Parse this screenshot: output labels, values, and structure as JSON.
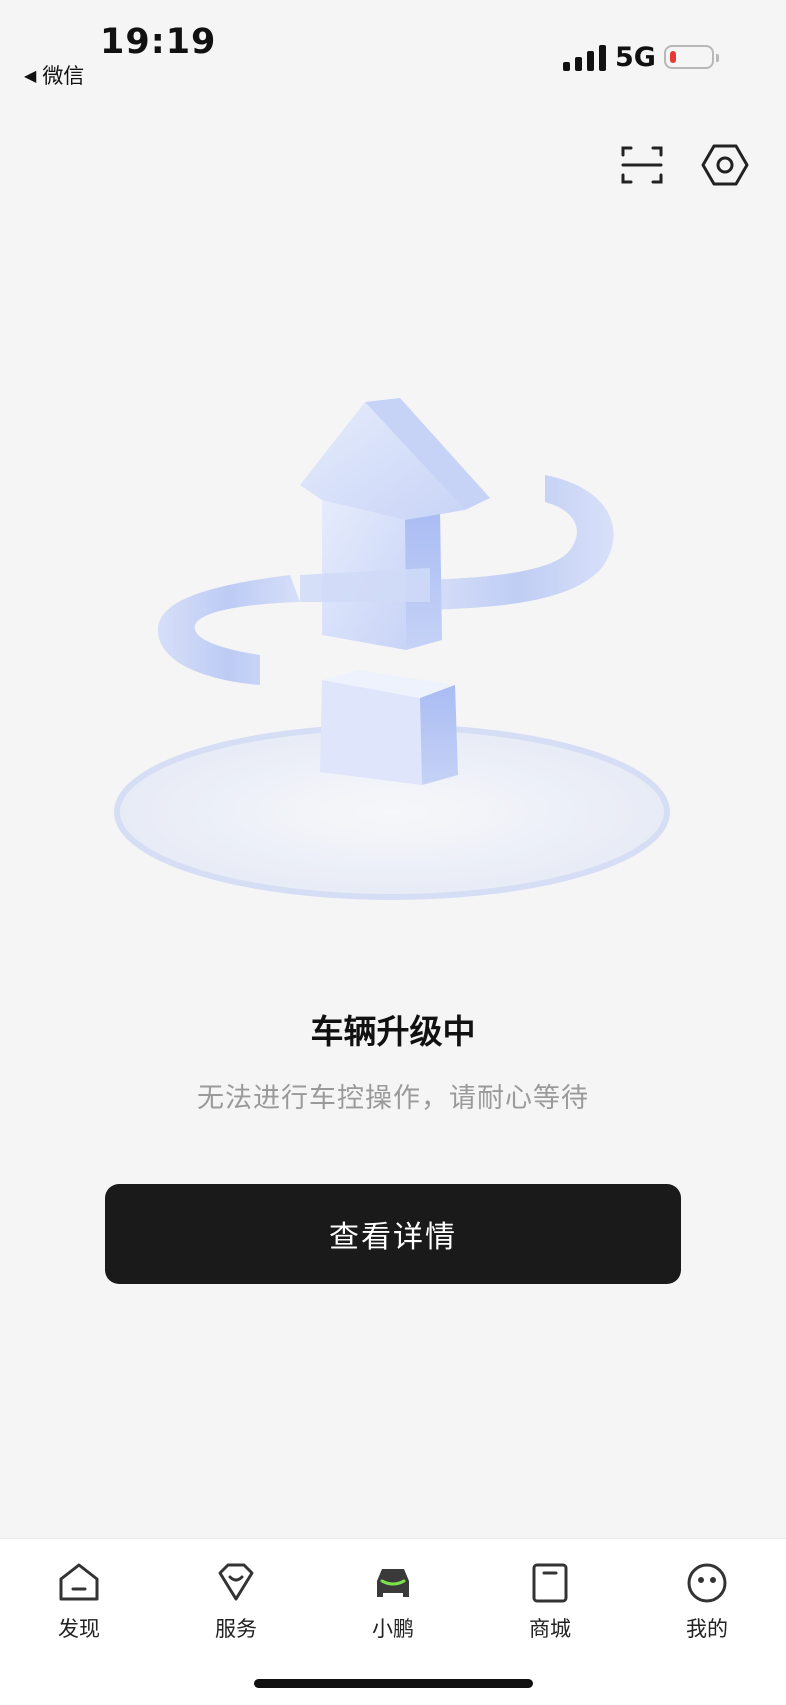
{
  "status_bar": {
    "time": "19:19",
    "back_app": "微信",
    "network": "5G",
    "battery_color": "#e53935"
  },
  "header": {
    "scan_icon": "scan-icon",
    "settings_icon": "hexagon-gear-icon"
  },
  "upgrade": {
    "illustration": "upgrade-arrow-icon",
    "title": "车辆升级中",
    "subtitle": "无法进行车控操作，请耐心等待",
    "button_label": "查看详情"
  },
  "tabs": [
    {
      "label": "发现",
      "icon": "discover-icon"
    },
    {
      "label": "服务",
      "icon": "service-icon"
    },
    {
      "label": "小鹏",
      "icon": "car-icon",
      "active": true
    },
    {
      "label": "商城",
      "icon": "shop-bag-icon"
    },
    {
      "label": "我的",
      "icon": "profile-face-icon"
    }
  ],
  "colors": {
    "background": "#f5f5f5",
    "button": "#1a1a1a",
    "accent_green": "#7be04a",
    "illustration_blue": "#b9c8f5"
  }
}
